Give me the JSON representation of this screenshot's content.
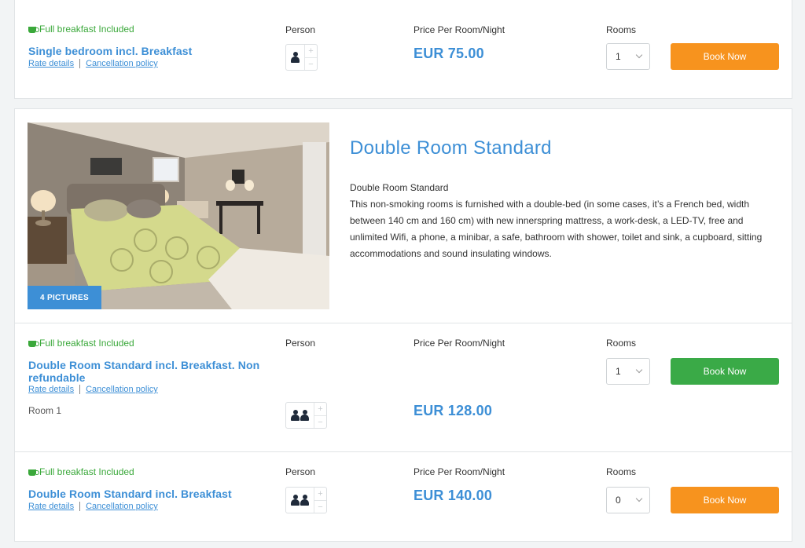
{
  "col_headers": {
    "person": "Person",
    "price": "Price Per Room/Night",
    "rooms": "Rooms"
  },
  "top_rate": {
    "breakfast": "Full breakfast Included",
    "title": "Single bedroom incl. Breakfast",
    "rate_details": "Rate details",
    "cancellation": "Cancellation policy",
    "price": "EUR 75.00",
    "rooms_value": "1",
    "book_label": "Book Now",
    "persons": 1
  },
  "room": {
    "pictures_badge": "4 PICTURES",
    "heading": "Double Room Standard",
    "subtitle": "Double Room Standard",
    "description": "This non-smoking rooms is furnished with a double-bed (in some cases, it’s a French bed, width between 140 cm and 160 cm) with new innerspring mattress, a work-desk, a LED-TV, free and unlimited Wifi, a phone, a minibar, a safe, bathroom with shower, toilet and sink, a cupboard, sitting accommodations and sound insulating windows."
  },
  "rate_nonref": {
    "breakfast": "Full breakfast Included",
    "title": "Double Room Standard incl. Breakfast. Non refundable",
    "rate_details": "Rate details",
    "cancellation": "Cancellation policy",
    "room_label": "Room 1",
    "price": "EUR 128.00",
    "rooms_value": "1",
    "book_label": "Book Now",
    "persons": 2
  },
  "rate_std": {
    "breakfast": "Full breakfast Included",
    "title": "Double Room Standard incl. Breakfast",
    "rate_details": "Rate details",
    "cancellation": "Cancellation policy",
    "price": "EUR 140.00",
    "rooms_value": "0",
    "book_label": "Book Now",
    "persons": 2
  },
  "colors": {
    "accent_blue": "#3d8fd6",
    "breakfast_green": "#3aa83a",
    "book_orange": "#f7931e",
    "book_green": "#3aaa47"
  },
  "icons": {
    "breakfast": "coffee-cup-icon",
    "person": "person-icon",
    "select": "chevron-down-icon"
  }
}
